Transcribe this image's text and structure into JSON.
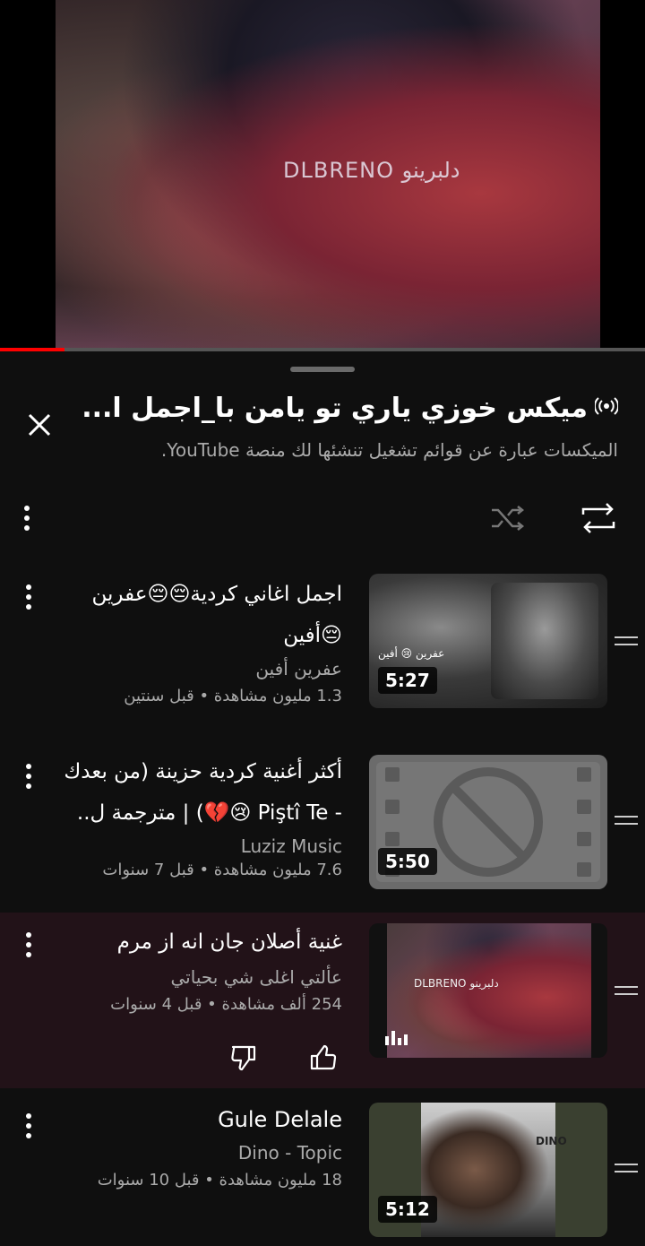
{
  "player": {
    "watermark": "DLBRENO دلبرينو",
    "progress_fraction": 0.1
  },
  "panel": {
    "mix_title": "ميكس خوزي ياري تو يامن با_اجمل ا...",
    "subtitle": "الميكسات عبارة عن قوائم تشغيل تنشئها لك منصة YouTube."
  },
  "playlist": [
    {
      "title_line1": "اجمل اغاني كردية😔😔عفرين",
      "title_line2": "😔أفين",
      "channel": "عفرين أفين",
      "meta": "1.3 مليون مشاهدة • قبل سنتين",
      "duration": "5:27",
      "thumb_label": "عفرين 😢 أفين"
    },
    {
      "title_line1": "أكثر أغنية كردية حزينة (من بعدك",
      "title_line2": "- Piştî Te 😢💔) | مترجمة ل..",
      "channel": "Luziz Music",
      "meta": "7.6 مليون مشاهدة • قبل 7 سنوات",
      "duration": "5:50"
    },
    {
      "title_line1": "غنية أصلان جان انه از مرم",
      "channel": "عألتي اغلى شي بحياتي",
      "meta": "254 ألف مشاهدة • قبل 4 سنوات",
      "thumb_label": "DLBRENO دلبرينو"
    },
    {
      "title_line1": "Gule Delale",
      "channel": "Dino - Topic",
      "meta": "18 مليون مشاهدة • قبل 10 سنوات",
      "duration": "5:12",
      "thumb_label": "DINO"
    }
  ],
  "colors": {
    "accent": "#ff0000",
    "background": "#0f0f0f",
    "active_row": "#221218"
  }
}
